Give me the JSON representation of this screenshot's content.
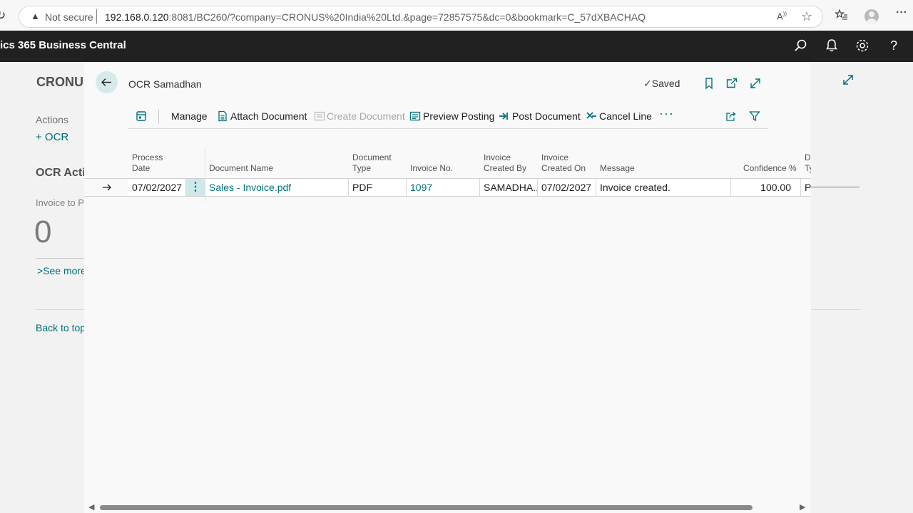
{
  "browser": {
    "security_label": "Not secure",
    "url_host": "192.168.0.120",
    "url_rest": ":8081/BC260/?company=CRONUS%20India%20Ltd.&page=72857575&dc=0&bookmark=C_57dXBACHAQ"
  },
  "app": {
    "title": "ics 365 Business Central"
  },
  "background_page": {
    "company": "CRONUS",
    "actions_label": "Actions",
    "ocr_action": "+ OCR",
    "ocr_activities": "OCR Activ",
    "invoice_to": "Invoice to Po",
    "invoice_count": "0",
    "see_more": "See more",
    "back_to_top": "Back to top"
  },
  "dialog": {
    "title": "OCR Samadhan",
    "status": "Saved",
    "actions": {
      "manage": "Manage",
      "attach_document": "Attach Document",
      "create_document": "Create Document",
      "preview_posting": "Preview Posting",
      "post_document": "Post Document",
      "cancel_line": "Cancel Line"
    },
    "columns": {
      "process_date": [
        "Process",
        "Date"
      ],
      "document_name": "Document Name",
      "document_type": [
        "Document",
        "Type"
      ],
      "invoice_no": "Invoice No.",
      "invoice_created_by": [
        "Invoice",
        "Created By"
      ],
      "invoice_created_on": [
        "Invoice",
        "Created On"
      ],
      "message": "Message",
      "confidence": "Confidence %",
      "doc_ty": [
        "Do",
        "Ty"
      ]
    },
    "rows": [
      {
        "process_date": "07/02/2027",
        "document_name": "Sales - Invoice.pdf",
        "document_type": "PDF",
        "invoice_no": "1097",
        "created_by": "SAMADHA...",
        "created_on": "07/02/2027",
        "message": "Invoice created.",
        "confidence": "100.00",
        "extra": "P"
      }
    ]
  },
  "colors": {
    "accent": "#00707a",
    "app_bar": "#212121"
  }
}
